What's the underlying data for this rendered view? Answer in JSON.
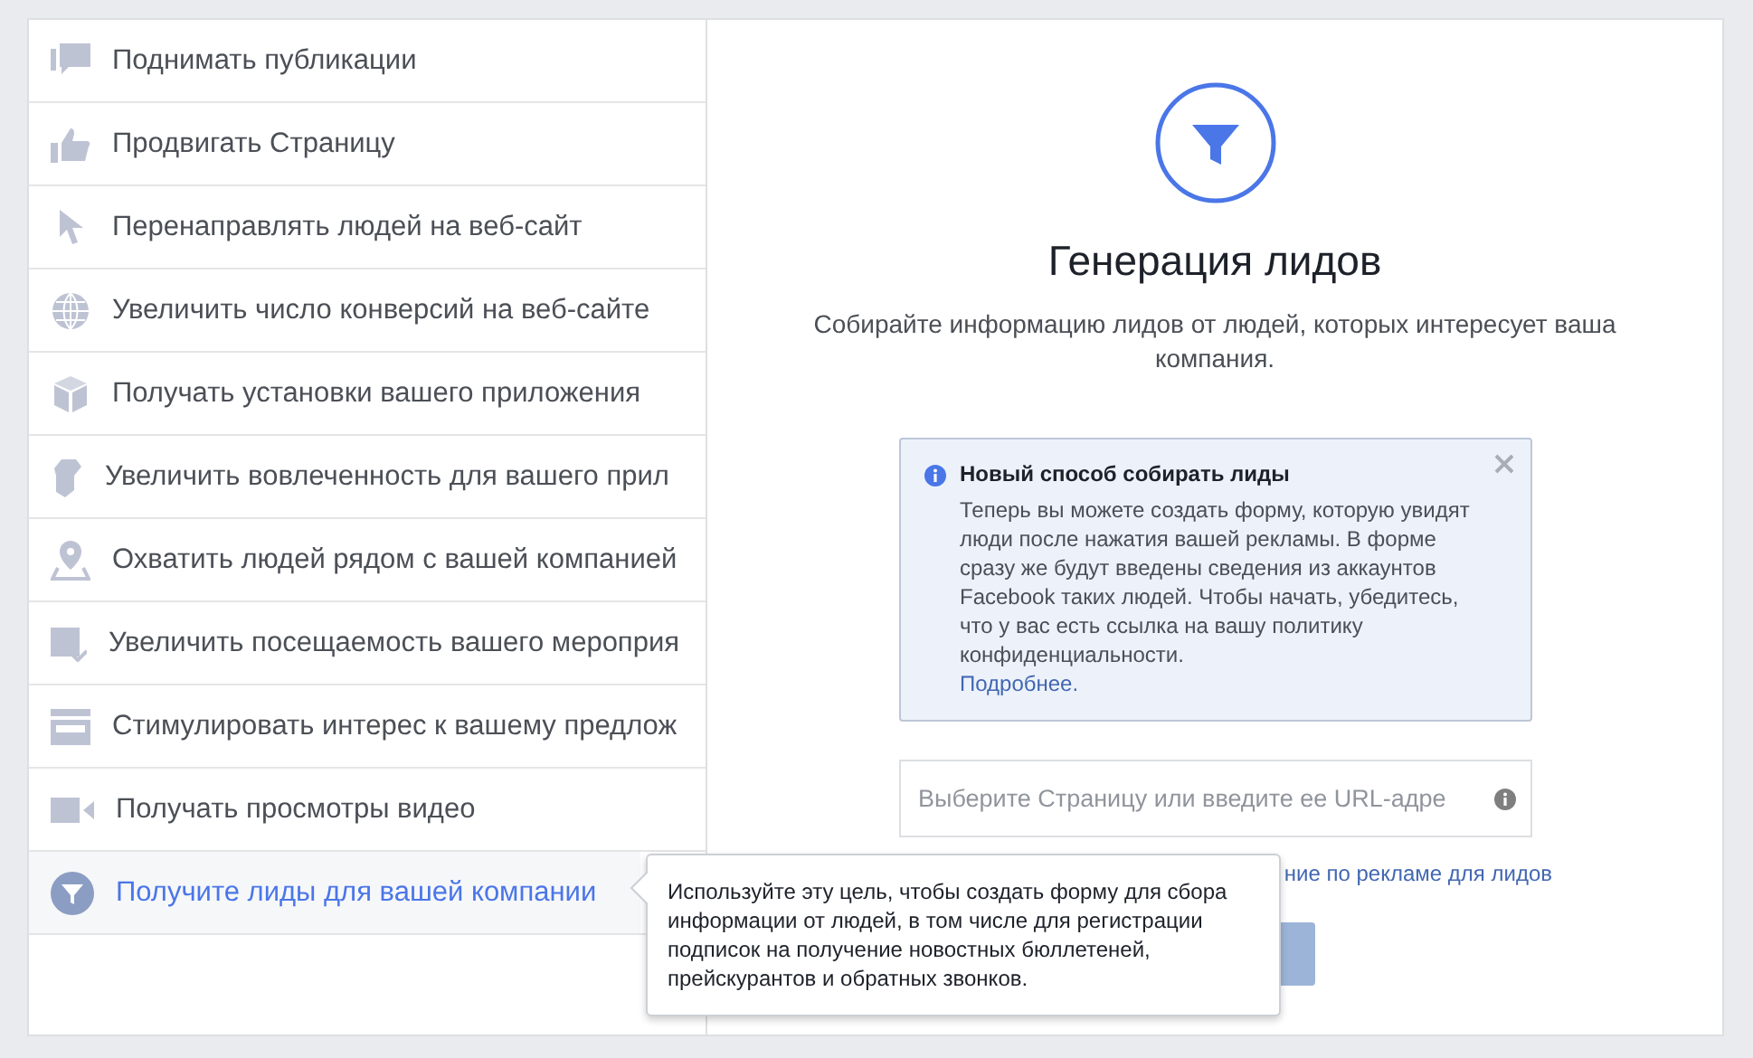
{
  "objectives": [
    {
      "label": "Поднимать публикации",
      "selected": false
    },
    {
      "label": "Продвигать Страницу",
      "selected": false
    },
    {
      "label": "Перенаправлять людей на веб-сайт",
      "selected": false
    },
    {
      "label": "Увеличить число конверсий на веб-сайте",
      "selected": false
    },
    {
      "label": "Получать установки вашего приложения",
      "selected": false
    },
    {
      "label": "Увеличить вовлеченность для вашего прил",
      "selected": false
    },
    {
      "label": "Охватить людей рядом с вашей компанией",
      "selected": false
    },
    {
      "label": "Увеличить посещаемость вашего мероприя",
      "selected": false
    },
    {
      "label": "Стимулировать интерес к вашему предлож",
      "selected": false
    },
    {
      "label": "Получать просмотры видео",
      "selected": false
    },
    {
      "label": "Получите лиды для вашей компании",
      "selected": true
    }
  ],
  "tooltip": "Используйте эту цель, чтобы создать форму для сбора информации от людей, в том числе для регистрации подписок на получение новостных бюллетеней, прейскурантов и обратных звонков.",
  "detail": {
    "title": "Генерация лидов",
    "subtitle": "Собирайте информацию лидов от людей, которых интересует ваша компания.",
    "notice": {
      "title": "Новый способ собирать лиды",
      "body": "Теперь вы можете создать форму, которую увидят люди после нажатия вашей рекламы. В форме сразу же будут введены сведения из аккаунтов Facebook таких людей. Чтобы начать, убедитесь, что у вас есть ссылка на вашу политику конфиденциальности.",
      "link": "Подробнее."
    },
    "page_field": {
      "placeholder": "Выберите Страницу или введите ее URL-адре"
    },
    "terms_link": "ние по рекламе для лидов"
  }
}
